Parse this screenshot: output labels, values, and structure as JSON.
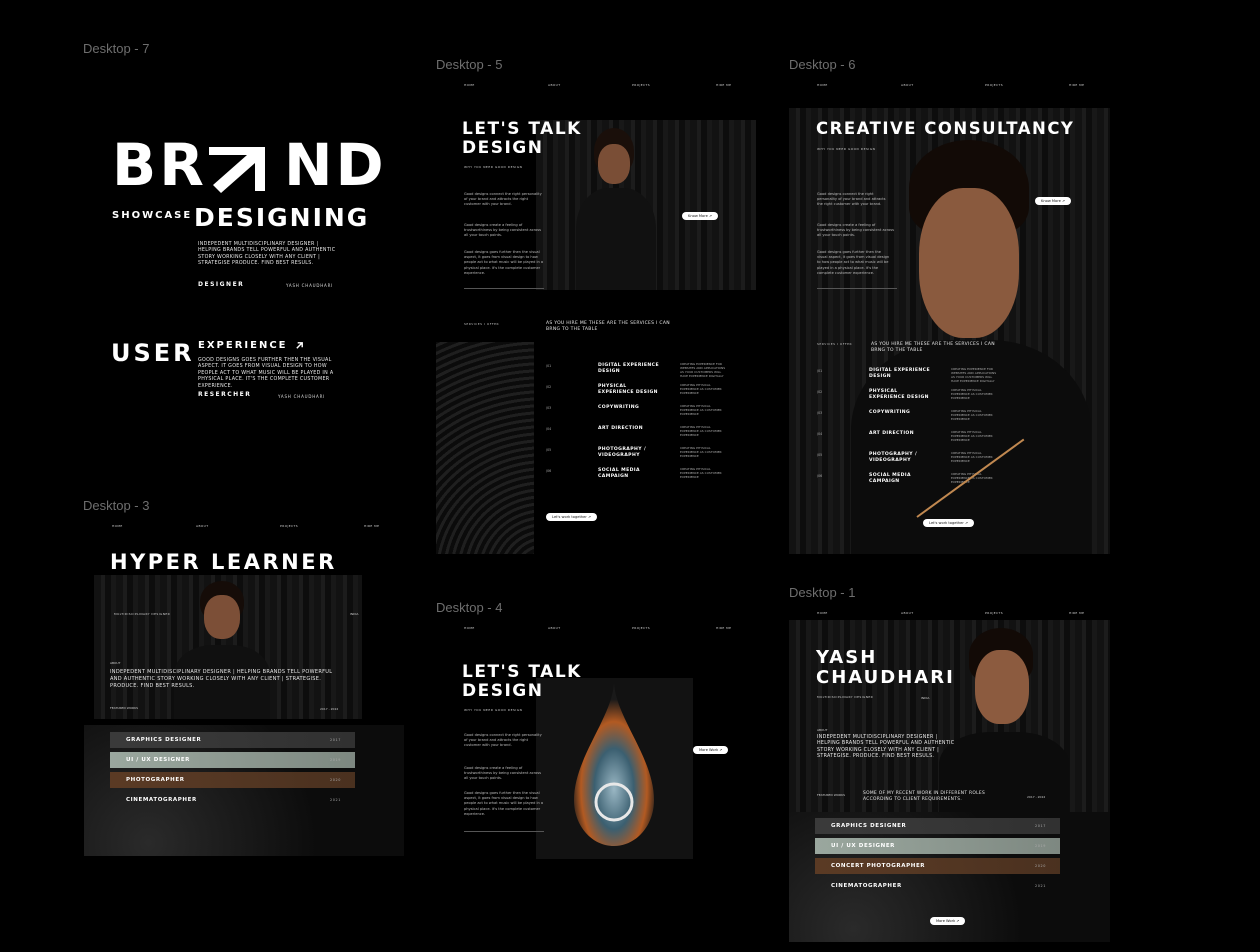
{
  "frames": {
    "d7": {
      "label": "Desktop - 7",
      "brand_left": "BR",
      "brand_right": "ND",
      "showcase": "SHOWCASE",
      "designing": "DESIGNING",
      "intro": "INDEPEDENT MULTIDISCIPLINARY DESIGNER | HELPING BRANDS TELL POWERFUL AND AUTHENTIC STORY WORKING CLOSELY WITH ANY CLIENT | STRATEGISE PRODUCE. FIND BEST RESULS.",
      "role1": "DESIGNER",
      "name1": "YASH CHAUDHARI",
      "user": "USER",
      "experience": "EXPERIENCE",
      "ux_text": "GOOD DESIGNS GOES FURTHER THEN THE VISUAL ASPECT. IT GOES FROM VISUAL DESIGN TO HOW PEOPLE ACT TO WHAT MUSIC WILL BE PLAYED IN A PHYSICAL PLACE. IT'S THE COMPLETE CUSTOMER EXPERIENCE.",
      "role2": "RESERCHER",
      "name2": "YASH CHAUDHARI"
    },
    "nav": {
      "home": "HOME",
      "about": "ABOUT",
      "projects": "PROJECTS",
      "hire": "HIRE ME"
    },
    "d5": {
      "label": "Desktop - 5",
      "title_l1": "LET'S TALK",
      "title_l2": "DESIGN",
      "sub": "WHY YOU NEED GOOD DESIGN",
      "p1": "Good designs connect the right personality of your brand and attracts the right customer with your brand.",
      "p2": "Good designs create a feeling of trustworthiness by being consistent across all your touch points.",
      "p3": "Good designs goes further then the visual aspect, it goes from visual design to how people act to what music will be played in a physical place. it's the complete customer experience.",
      "know_more": "Know More ↗",
      "services_tag": "SERVICES I OFFER",
      "services_head": "AS YOU HIRE ME THESE ARE THE SERVICES I CAN BRNG TO THE TABLE",
      "services": [
        {
          "num": "/01",
          "name": "DIGITAL EXPERIENCE DESIGN",
          "desc": "CREATING EXPERIENCE FOR WEBSITES AND APPLICATIONS AS YOUR CUSTOMERS WILL HAVE EXPERIENCE DIGITALLY"
        },
        {
          "num": "/02",
          "name": "PHYSICAL EXPERIENCE DESIGN",
          "desc": "CREATING PHYSICAL EXPERIENCE AS CUSTOMER EXPERIENCE"
        },
        {
          "num": "/03",
          "name": "COPYWRITING",
          "desc": "CREATING PHYSICAL EXPERIENCE AS CUSTOMER EXPERIENCE"
        },
        {
          "num": "/04",
          "name": "ART DIRECTION",
          "desc": "CREATING PHYSICAL EXPERIENCE AS CUSTOMER EXPERIENCE"
        },
        {
          "num": "/05",
          "name": "PHOTOGRAPHY / VIDEOGRAPHY",
          "desc": "CREATING PHYSICAL EXPERIENCE AS CUSTOMER EXPERIENCE"
        },
        {
          "num": "/06",
          "name": "SOCIAL MEDIA CAMPAIGN",
          "desc": "CREATING PHYSICAL EXPERIENCE AS CUSTOMER EXPERIENCE"
        }
      ],
      "work_together": "Let's work together ↗"
    },
    "d6": {
      "label": "Desktop - 6",
      "title": "CREATIVE CONSULTANCY",
      "sub": "WHY YOU NEED GOOD DESIGN",
      "p1": "Good designs connect the right personality of your brand and attracts the right customer with your brand.",
      "p2": "Good designs create a feeling of trustworthiness by being consistent across all your touch points.",
      "p3": "Good designs goes further then the visual aspect, it goes from visual design to how people act to what music will be played in a physical place. it's the complete customer experience.",
      "know_more": "Know More ↗",
      "services_tag": "SERVICES I OFFER",
      "services_head": "AS YOU HIRE ME THESE ARE THE SERVICES I CAN BRNG TO THE TABLE",
      "services": [
        {
          "num": "/01",
          "name": "DIGITAL EXPERIENCE DESIGN",
          "desc": "CREATING EXPERIENCE FOR WEBSITES AND APPLICATIONS AS YOUR CUSTOMERS WILL HAVE EXPERIENCE DIGITALLY"
        },
        {
          "num": "/02",
          "name": "PHYSICAL EXPERIENCE DESIGN",
          "desc": "CREATING PHYSICAL EXPERIENCE AS CUSTOMER EXPERIENCE"
        },
        {
          "num": "/03",
          "name": "COPYWRITING",
          "desc": "CREATING PHYSICAL EXPERIENCE AS CUSTOMER EXPERIENCE"
        },
        {
          "num": "/04",
          "name": "ART DIRECTION",
          "desc": "CREATING PHYSICAL EXPERIENCE AS CUSTOMER EXPERIENCE"
        },
        {
          "num": "/05",
          "name": "PHOTOGRAPHY / VIDEOGRAPHY",
          "desc": "CREATING PHYSICAL EXPERIENCE AS CUSTOMER EXPERIENCE"
        },
        {
          "num": "/06",
          "name": "SOCIAL MEDIA CAMPAIGN",
          "desc": "CREATING PHYSICAL EXPERIENCE AS CUSTOMER EXPERIENCE"
        }
      ],
      "work_together": "Let's work together ↗"
    },
    "d3": {
      "label": "Desktop - 3",
      "title": "HYPER LEARNER",
      "role": "MULTIDISCIPLINARY DESIGNER",
      "country": "INDIA",
      "about": "ABOUT",
      "about_text": "INDEPEDENT MULTIDISCIPLINARY DESIGNER | HELPING BRANDS TELL POWERFUL AND AUTHENTIC STORY WORKING CLOSELY WITH ANY CLIENT | STRATEGISE. PRODUCE. FIND BEST RESULS.",
      "featured": "FEATURED WORKS",
      "years": "2017 - 2022",
      "works": [
        {
          "name": "GRAPHICS DESIGNER",
          "year": "2017"
        },
        {
          "name": "UI / UX DESIGNER",
          "year": "2019"
        },
        {
          "name": "PHOTOGRAPHER",
          "year": "2020"
        },
        {
          "name": "CINEMATOGRAPHER",
          "year": "2021"
        }
      ]
    },
    "d4": {
      "label": "Desktop - 4",
      "title_l1": "LET'S TALK",
      "title_l2": "DESIGN",
      "sub": "WHY YOU NEED GOOD DESIGN",
      "p1": "Good designs connect the right personality of your brand and attracts the right customer with your brand.",
      "p2": "Good designs create a feeling of trustworthiness by being consistent across all your touch points.",
      "p3": "Good designs goes further then the visual aspect, it goes from visual design to how people act to what music will be played in a physical place. it's the complete customer experience.",
      "more_work": "More Work ↗"
    },
    "d1": {
      "label": "Desktop - 1",
      "name_l1": "YASH",
      "name_l2": "CHAUDHARI",
      "role": "MULTIDISCIPLINARY DESIGNER",
      "country": "INDIA",
      "about": "ABOUT",
      "about_text": "INDEPEDENT MULTIDISCIPLINARY DESIGNER | HELPING BRANDS TELL POWERFUL AND AUTHENTIC STORY WORKING CLOSELY WITH ANY CLIENT | STRATEGISE. PRODUCE. FIND BEST RESULS.",
      "featured": "FEATURED WORKS",
      "featured_text": "SOME OF MY RECENT WORK IN DIFFERENT ROLES ACCORDING TO CLIENT REQUIREMENTS.",
      "years": "2017 - 2022",
      "works": [
        {
          "name": "GRAPHICS DESIGNER",
          "year": "2017"
        },
        {
          "name": "UI / UX DESIGNER",
          "year": "2019"
        },
        {
          "name": "CONCERT PHOTOGRAPHER",
          "year": "2020"
        },
        {
          "name": "CINEMATOGRAPHER",
          "year": "2021"
        }
      ],
      "more_work": "More Work ↗"
    }
  }
}
